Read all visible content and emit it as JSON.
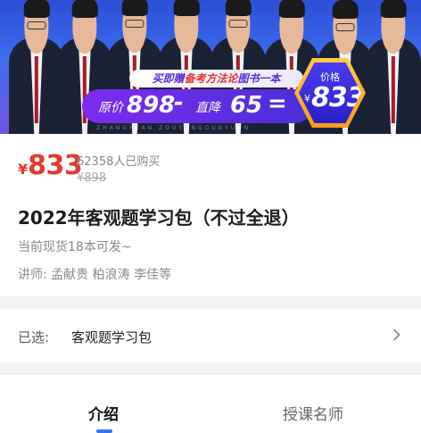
{
  "banner": {
    "promo_prefix": "买即赠",
    "promo_highlight": "备考方法论",
    "promo_suffix": "图书一本",
    "original_label": "原价",
    "original_value": "898",
    "minus": "-",
    "discount_label": "直降",
    "discount_value": "65",
    "equals": "=",
    "badge_label": "价格",
    "badge_currency": "¥",
    "badge_value": "833",
    "watermark": "ZHANGYUAN ZOUYUNGOUNYUUN",
    "teacher_count": 8
  },
  "product": {
    "currency": "¥",
    "price": "833",
    "sold_count": "62358人已购买",
    "original_price": "¥898",
    "title": "2022年客观题学习包（不过全退）",
    "stock_note": "当前现货18本可发~",
    "lecturers": "讲师: 孟献贵 柏浪涛 李佳等"
  },
  "selection": {
    "label": "已选:",
    "value": "客观题学习包"
  },
  "tabs": [
    {
      "label": "介绍",
      "active": true
    },
    {
      "label": "授课名师",
      "active": false
    }
  ],
  "colors": {
    "price_red": "#e6382f",
    "accent_blue": "#3474f5",
    "badge_gold": "#ffb020",
    "pill_purple": "#6a2ee8"
  }
}
